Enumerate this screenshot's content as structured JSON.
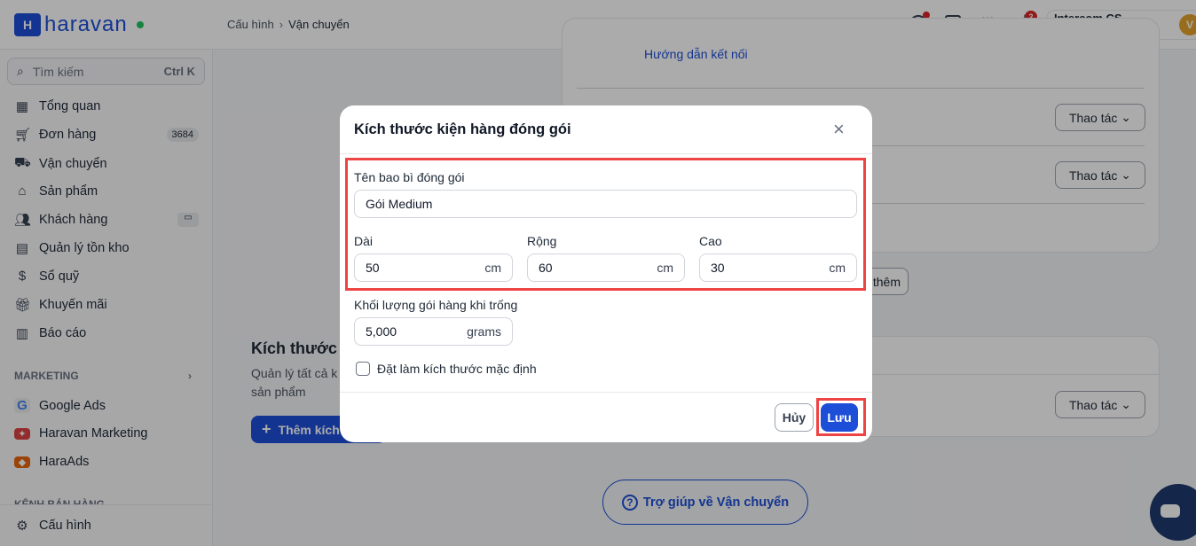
{
  "header": {
    "logo": "haravan",
    "breadcrumb": [
      "Cấu hình",
      "Vận chuyển"
    ],
    "notifications_count": "2",
    "account_name": "Intercom CS Haravan",
    "avatar_letter": "V"
  },
  "sidebar": {
    "search_placeholder": "Tìm kiếm",
    "search_shortcut": "Ctrl K",
    "items": [
      {
        "label": "Tổng quan",
        "icon": "dashboard-icon"
      },
      {
        "label": "Đơn hàng",
        "icon": "cart-icon",
        "badge": "3684"
      },
      {
        "label": "Vận chuyển",
        "icon": "truck-icon"
      },
      {
        "label": "Sản phẩm",
        "icon": "tag-icon"
      },
      {
        "label": "Khách hàng",
        "icon": "users-icon"
      },
      {
        "label": "Quản lý tồn kho",
        "icon": "inventory-icon"
      },
      {
        "label": "Sổ quỹ",
        "icon": "cash-icon"
      },
      {
        "label": "Khuyến mãi",
        "icon": "gift-icon"
      },
      {
        "label": "Báo cáo",
        "icon": "chart-icon"
      }
    ],
    "marketing_heading": "MARKETING",
    "marketing_items": [
      {
        "label": "Google Ads"
      },
      {
        "label": "Haravan Marketing"
      },
      {
        "label": "HaraAds"
      }
    ],
    "sales_channel_heading": "KÊNH BÁN HÀNG",
    "settings_label": "Cấu hình"
  },
  "main": {
    "connect_guide_link": "Hướng dẫn kết nối",
    "action_label": "Thao tác",
    "add_more_label": "thêm",
    "section_title": "Kích thước",
    "section_desc_1": "Quản lý tất cả k",
    "section_desc_2": "sản phẩm",
    "add_size_button": "Thêm kích",
    "help_button": "Trợ giúp về Vận chuyển"
  },
  "modal": {
    "title": "Kích thước kiện hàng đóng gói",
    "package_name_label": "Tên bao bì đóng gói",
    "package_name_value": "Gói Medium",
    "length_label": "Dài",
    "length_value": "50",
    "width_label": "Rộng",
    "width_value": "60",
    "height_label": "Cao",
    "height_value": "30",
    "dim_unit": "cm",
    "weight_label": "Khối lượng gói hàng khi trống",
    "weight_value": "5,000",
    "weight_unit": "grams",
    "default_checkbox_label": "Đặt làm kích thước mặc định",
    "default_checked": false,
    "cancel_label": "Hủy",
    "save_label": "Lưu"
  },
  "colors": {
    "primary": "#1d4ed8",
    "highlight": "#ef4444",
    "avatar": "#e5a32e",
    "online": "#22c55e"
  }
}
